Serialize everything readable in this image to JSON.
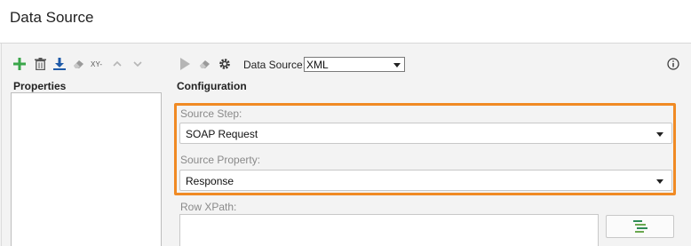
{
  "window": {
    "title": "Data Source"
  },
  "left_toolbar": {
    "icons": [
      "add-icon",
      "delete-icon",
      "download-icon",
      "eraser-icon",
      "xy-icon",
      "move-up-icon",
      "move-down-icon"
    ],
    "xy_label": "XY-"
  },
  "right_toolbar": {
    "icons": [
      "run-icon",
      "eraser-icon",
      "settings-icon",
      "info-icon"
    ],
    "datasource_label": "Data Source:",
    "datasource_value": "XML"
  },
  "properties": {
    "heading": "Properties"
  },
  "configuration": {
    "heading": "Configuration",
    "source_step": {
      "label": "Source Step:",
      "value": "SOAP Request"
    },
    "source_property": {
      "label": "Source Property:",
      "value": "Response"
    },
    "row_xpath": {
      "label": "Row XPath:",
      "value": ""
    }
  },
  "colors": {
    "highlight": "#f08a24",
    "add_green": "#3aa64a",
    "download_blue": "#1e5aa8"
  }
}
